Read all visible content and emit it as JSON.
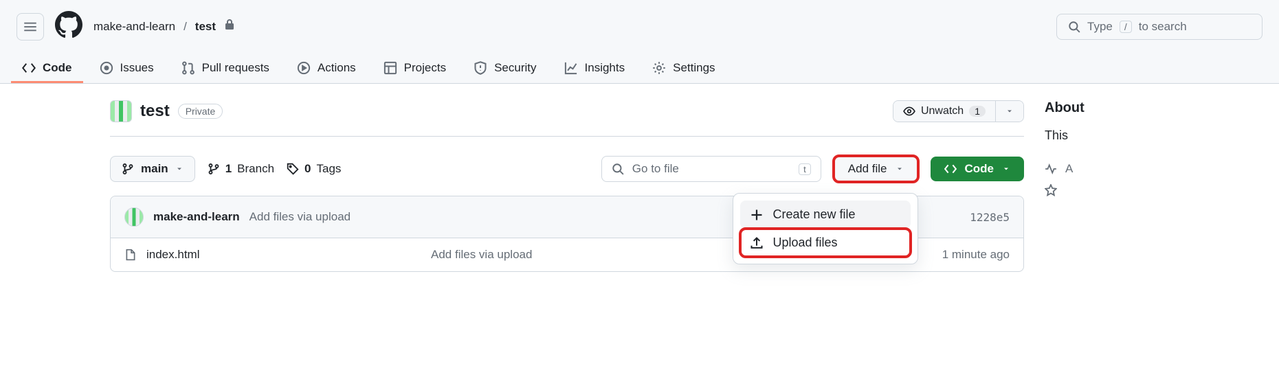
{
  "breadcrumb": {
    "owner": "make-and-learn",
    "repo": "test"
  },
  "search": {
    "prefix": "Type",
    "kbd": "/",
    "suffix": "to search"
  },
  "tabs": {
    "code": "Code",
    "issues": "Issues",
    "pulls": "Pull requests",
    "actions": "Actions",
    "projects": "Projects",
    "security": "Security",
    "insights": "Insights",
    "settings": "Settings"
  },
  "repo": {
    "name": "test",
    "visibility": "Private",
    "unwatch_label": "Unwatch",
    "watch_count": "1"
  },
  "controls": {
    "branch": "main",
    "branch_count": "1",
    "branch_label": "Branch",
    "tag_count": "0",
    "tag_label": "Tags",
    "gotofile_placeholder": "Go to file",
    "gotofile_kbd": "t",
    "addfile": "Add file",
    "code": "Code"
  },
  "addfile_menu": {
    "create": "Create new file",
    "upload": "Upload files"
  },
  "commit": {
    "author": "make-and-learn",
    "message": "Add files via upload",
    "sha": "1228e5"
  },
  "files": [
    {
      "name": "index.html",
      "message": "Add files via upload",
      "time": "1 minute ago"
    }
  ],
  "about": {
    "heading": "About",
    "desc": "This"
  }
}
